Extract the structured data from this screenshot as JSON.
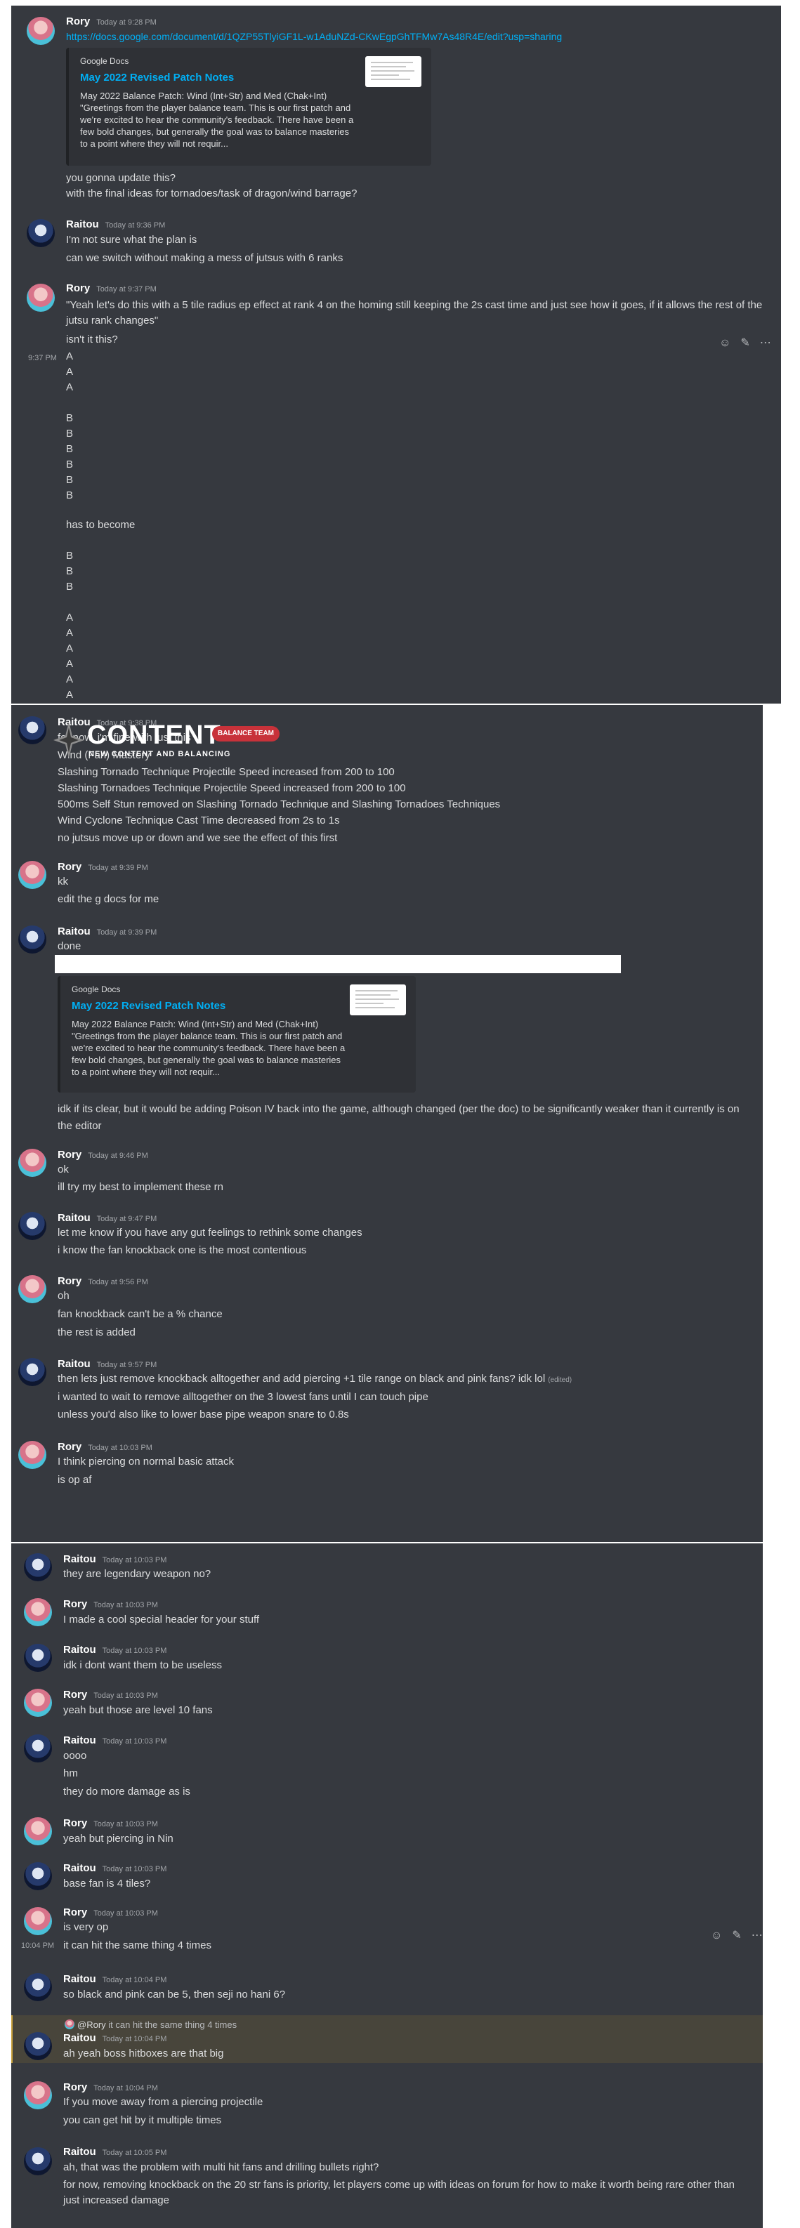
{
  "users": {
    "rory": "Rory",
    "raitou": "Raitou"
  },
  "embed": {
    "provider": "Google Docs",
    "title": "May 2022 Revised Patch Notes",
    "description": "May 2022 Balance Patch: Wind (Int+Str) and Med (Chak+Int)\n\"Greetings from the player balance team. This is our first patch and\nwe're excited to hear the community's feedback. There have been a\nfew bold changes, but generally the goal was to balance masteries\nto a point where they will not requir..."
  },
  "logo": {
    "word": "CONTENT",
    "sub": "NEW CONTENT AND BALANCING",
    "badge": "BALANCE TEAM"
  },
  "p1": {
    "m1": {
      "ts": "Today at 9:28 PM",
      "link": "https://docs.google.com/document/d/1QZP55TlyiGF1L-w1AduNZd-CKwEgpGhTFMw7As48R4E/edit?usp=sharing",
      "l1": "you gonna update this?",
      "l2": "with the final ideas for tornadoes/task of dragon/wind barrage?"
    },
    "m2": {
      "ts": "Today at 9:36 PM",
      "l1": "I'm not sure what the plan is",
      "l2": "can we switch without making a mess of jutsus with 6 ranks"
    },
    "m3": {
      "ts": "Today at 9:37 PM",
      "l1": "\"Yeah let's do this with a 5 tile radius ep effect at rank 4 on the homing still keeping the 2s cast time and just see how it goes, if it allows the rest of the jutsu rank changes\"",
      "l2": "isn't it this?"
    },
    "m4": {
      "ts": "9:37 PM",
      "lines": [
        "A",
        "A",
        "A",
        "",
        "B",
        "B",
        "B",
        "B",
        "B",
        "B",
        "",
        "has to become",
        "",
        "B",
        "B",
        "B",
        "",
        "A",
        "A",
        "A",
        "A",
        "A",
        "A"
      ]
    }
  },
  "p2": {
    "m1": {
      "ts": "Today at 9:38 PM",
      "lines": [
        "for now, i'm fine with just this",
        "Wind (Fan) Mastery",
        "Slashing Tornado Technique Projectile Speed increased from 200 to 100",
        "Slashing Tornadoes Technique Projectile Speed increased from 200 to 100",
        "500ms Self Stun removed on Slashing Tornado Technique and Slashing Tornadoes Techniques",
        "Wind Cyclone Technique Cast Time decreased from 2s to 1s",
        "no jutsus move up or down and we see the effect of this first"
      ]
    },
    "m2": {
      "ts": "Today at 9:39 PM",
      "l1": "kk",
      "l2": "edit the g docs for me"
    },
    "m3": {
      "ts": "Today at 9:39 PM",
      "l1": "done",
      "l2": "idk if its clear, but it would be adding Poison IV back into the game, although changed (per the doc) to be significantly weaker than it currently is on the editor"
    },
    "m4": {
      "ts": "Today at 9:46 PM",
      "l1": "ok",
      "l2": "ill try my best to implement these rn"
    },
    "m5": {
      "ts": "Today at 9:47 PM",
      "l1": "let me know if you have any gut feelings to rethink some changes",
      "l2": "i know the fan knockback one is the most contentious"
    },
    "m6": {
      "ts": "Today at 9:56 PM",
      "l1": "oh",
      "l2": "fan knockback can't be a % chance",
      "l3": "the rest is added"
    },
    "m7": {
      "ts": "Today at 9:57 PM",
      "l1": "then lets just remove knockback alltogether and add piercing +1 tile range on black and pink fans? idk lol",
      "edited": "(edited)",
      "l2": "i wanted to wait to remove alltogether on the 3 lowest fans until I can touch pipe",
      "l3": "unless you'd also like to lower base pipe weapon snare to 0.8s"
    },
    "m8": {
      "ts": "Today at 10:03 PM",
      "l1": "I think piercing on normal basic attack",
      "l2": "is op af"
    }
  },
  "p3": {
    "m1": {
      "ts": "Today at 10:03 PM",
      "l1": "they are legendary weapon no?"
    },
    "m2": {
      "ts": "Today at 10:03 PM",
      "l1": "I made a cool special header for your stuff"
    },
    "m3": {
      "ts": "Today at 10:03 PM",
      "l1": "idk i dont want them to be useless"
    },
    "m4": {
      "ts": "Today at 10:03 PM",
      "l1": "yeah but those are level 10 fans"
    },
    "m5": {
      "ts": "Today at 10:03 PM",
      "l1": "oooo",
      "l2": "hm",
      "l3": "they do more damage as is"
    },
    "m6": {
      "ts": "Today at 10:03 PM",
      "l1": "yeah but piercing in Nin"
    },
    "m7": {
      "ts": "Today at 10:03 PM",
      "l1": "base fan is 4 tiles?"
    },
    "m8": {
      "ts": "Today at 10:03 PM",
      "l1": "is very op",
      "hover_ts": "10:04 PM",
      "l2": "it can hit the same thing 4 times"
    },
    "m9": {
      "ts": "Today at 10:04 PM",
      "l1": "so black and pink can be 5, then seji no hani 6?"
    },
    "m10": {
      "reply_user": "@Rory",
      "reply_text": "it can hit the same thing 4 times",
      "ts": "Today at 10:04 PM",
      "l1": "ah yeah boss hitboxes are that big"
    },
    "m11": {
      "ts": "Today at 10:04 PM",
      "l1": "If you move away from a piercing projectile",
      "l2": "you can get hit by it multiple times"
    },
    "m12": {
      "ts": "Today at 10:05 PM",
      "l1": "ah, that was the problem with multi hit fans and drilling bullets right?",
      "l2": "for now, removing knockback on the 20 str fans is priority, let players come up with ideas on forum for how to make it worth being rare other than just increased damage"
    }
  },
  "icons": {
    "reaction": "add-reaction-icon",
    "edit": "pencil-icon",
    "more": "more-icon"
  }
}
